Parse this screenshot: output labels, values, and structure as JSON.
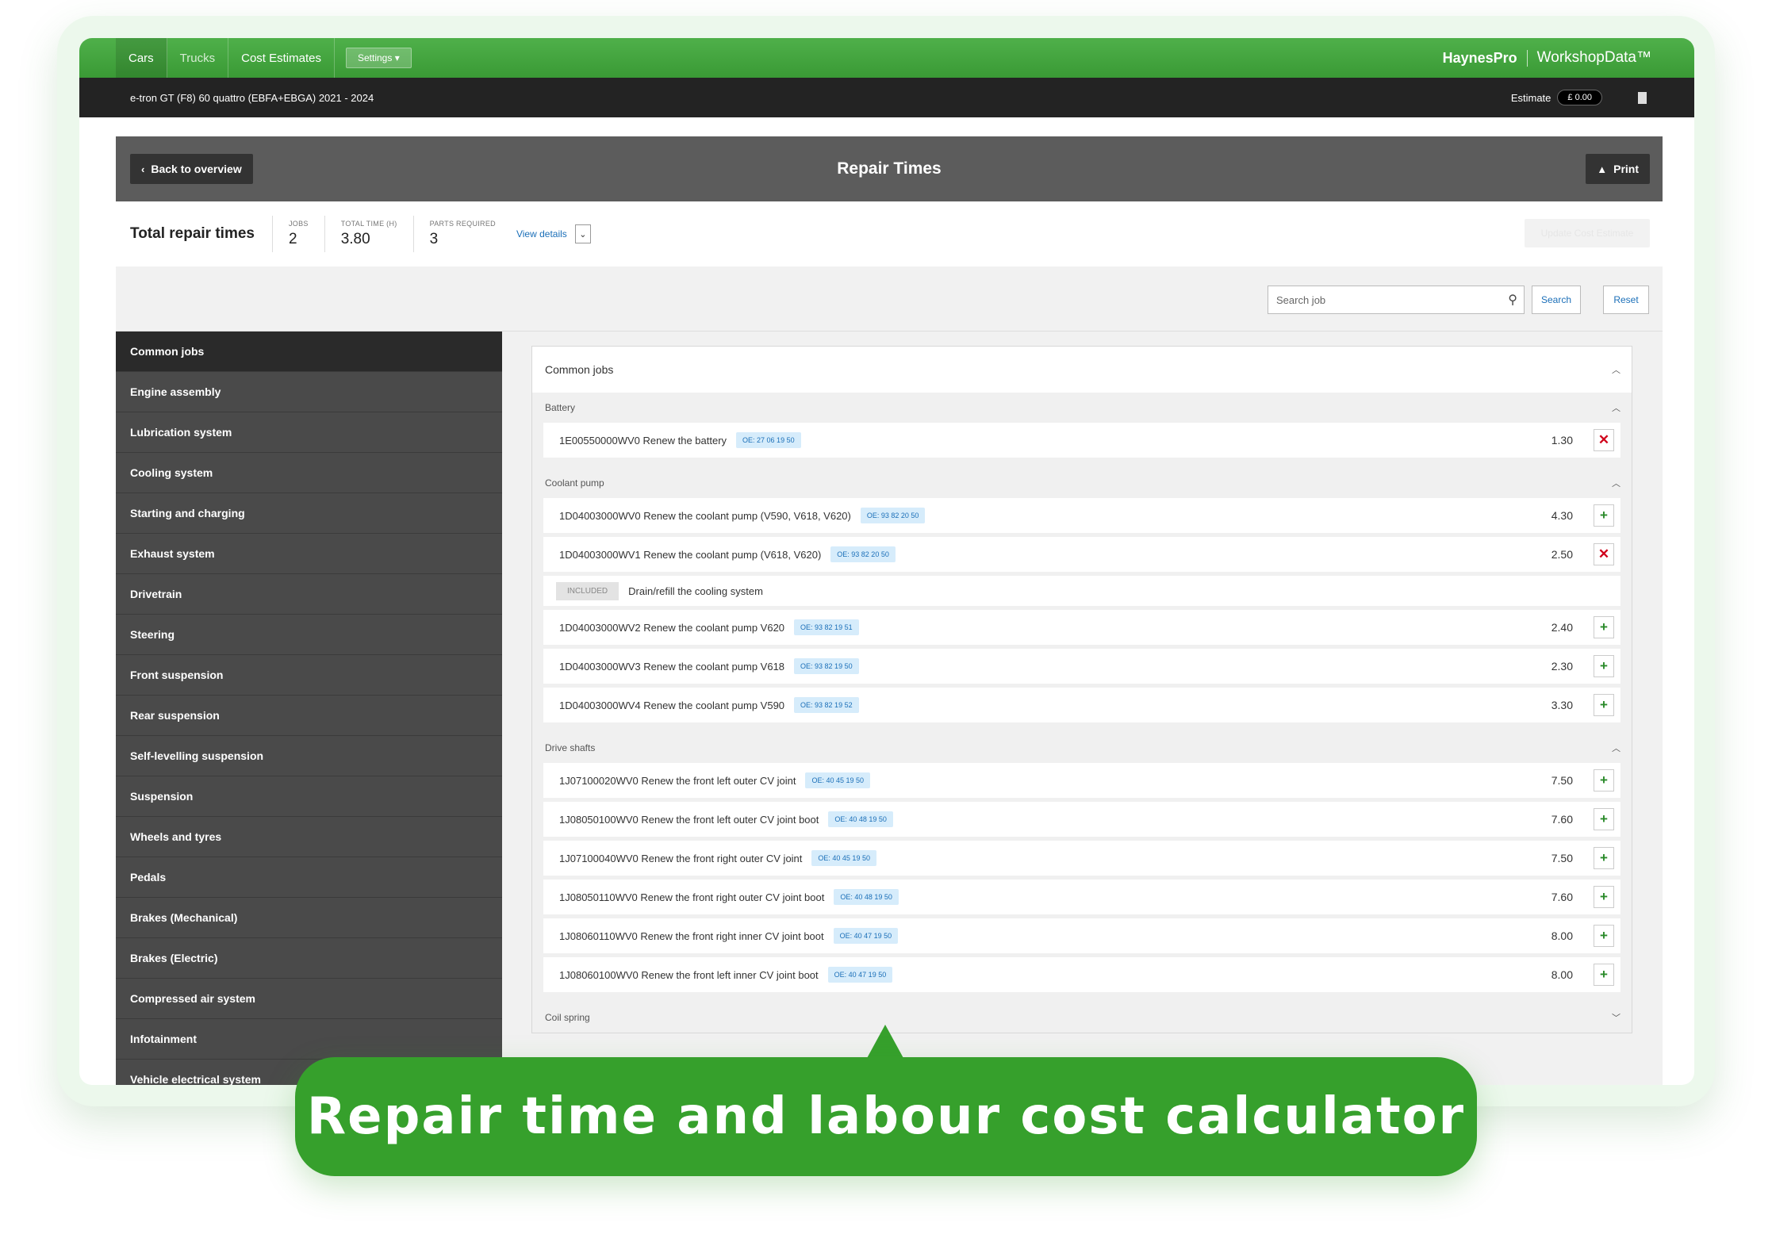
{
  "nav": {
    "items": [
      "Cars",
      "Trucks",
      "Cost Estimates"
    ],
    "settings_label": "Settings",
    "brand_primary": "HaynesPro",
    "brand_secondary": "WorkshopData™"
  },
  "vehicle": {
    "name": "e-tron GT (F8) 60 quattro (EBFA+EBGA) 2021 - 2024",
    "estimate_label": "Estimate",
    "estimate_value": "£ 0.00"
  },
  "page": {
    "title": "Repair Times",
    "back_label": "Back to overview",
    "print_label": "Print"
  },
  "summary": {
    "title": "Total repair times",
    "jobs_label": "JOBS",
    "jobs_value": "2",
    "time_label": "TOTAL TIME (H)",
    "time_value": "3.80",
    "parts_label": "PARTS REQUIRED",
    "parts_value": "3",
    "view_details": "View details",
    "update_label": "Update Cost Estimate"
  },
  "search": {
    "placeholder": "Search job",
    "search_label": "Search",
    "reset_label": "Reset"
  },
  "sidebar": {
    "items": [
      "Common jobs",
      "Engine assembly",
      "Lubrication system",
      "Cooling system",
      "Starting and charging",
      "Exhaust system",
      "Drivetrain",
      "Steering",
      "Front suspension",
      "Rear suspension",
      "Self-levelling suspension",
      "Suspension",
      "Wheels and tyres",
      "Pedals",
      "Brakes (Mechanical)",
      "Brakes (Electric)",
      "Compressed air system",
      "Infotainment",
      "Vehicle electrical system"
    ]
  },
  "panel": {
    "title": "Common jobs",
    "groups": [
      {
        "name": "Battery",
        "rows": [
          {
            "desc": "1E00550000WV0 Renew the battery",
            "oe": "OE: 27 06 19 50",
            "time": "1.30",
            "action": "remove"
          }
        ]
      },
      {
        "name": "Coolant pump",
        "rows": [
          {
            "desc": "1D04003000WV0 Renew the coolant pump (V590, V618, V620)",
            "oe": "OE: 93 82 20 50",
            "time": "4.30",
            "action": "add"
          },
          {
            "desc": "1D04003000WV1 Renew the coolant pump (V618, V620)",
            "oe": "OE: 93 82 20 50",
            "time": "2.50",
            "action": "remove"
          },
          {
            "included": true,
            "badge": "INCLUDED",
            "desc": "Drain/refill the cooling system"
          },
          {
            "desc": "1D04003000WV2 Renew the coolant pump V620",
            "oe": "OE: 93 82 19 51",
            "time": "2.40",
            "action": "add"
          },
          {
            "desc": "1D04003000WV3 Renew the coolant pump V618",
            "oe": "OE: 93 82 19 50",
            "time": "2.30",
            "action": "add"
          },
          {
            "desc": "1D04003000WV4 Renew the coolant pump V590",
            "oe": "OE: 93 82 19 52",
            "time": "3.30",
            "action": "add"
          }
        ]
      },
      {
        "name": "Drive shafts",
        "rows": [
          {
            "desc": "1J07100020WV0 Renew the front left outer CV joint",
            "oe": "OE: 40 45 19 50",
            "time": "7.50",
            "action": "add"
          },
          {
            "desc": "1J08050100WV0 Renew the front left outer CV joint boot",
            "oe": "OE: 40 48 19 50",
            "time": "7.60",
            "action": "add"
          },
          {
            "desc": "1J07100040WV0 Renew the front right outer CV joint",
            "oe": "OE: 40 45 19 50",
            "time": "7.50",
            "action": "add"
          },
          {
            "desc": "1J08050110WV0 Renew the front right outer CV joint boot",
            "oe": "OE: 40 48 19 50",
            "time": "7.60",
            "action": "add"
          },
          {
            "desc": "1J08060110WV0 Renew the front right inner CV joint boot",
            "oe": "OE: 40 47 19 50",
            "time": "8.00",
            "action": "add"
          },
          {
            "desc": "1J08060100WV0 Renew the front left inner CV joint boot",
            "oe": "OE: 40 47 19 50",
            "time": "8.00",
            "action": "add"
          }
        ]
      }
    ],
    "collapsed_group": "Coil spring"
  },
  "callout": {
    "text": "Repair time and labour cost calculator"
  },
  "colors": {
    "brand_green": "#3a9a35",
    "callout_green": "#36a02c",
    "oe_blue": "#1b6fb8",
    "remove_red": "#d0021b"
  }
}
